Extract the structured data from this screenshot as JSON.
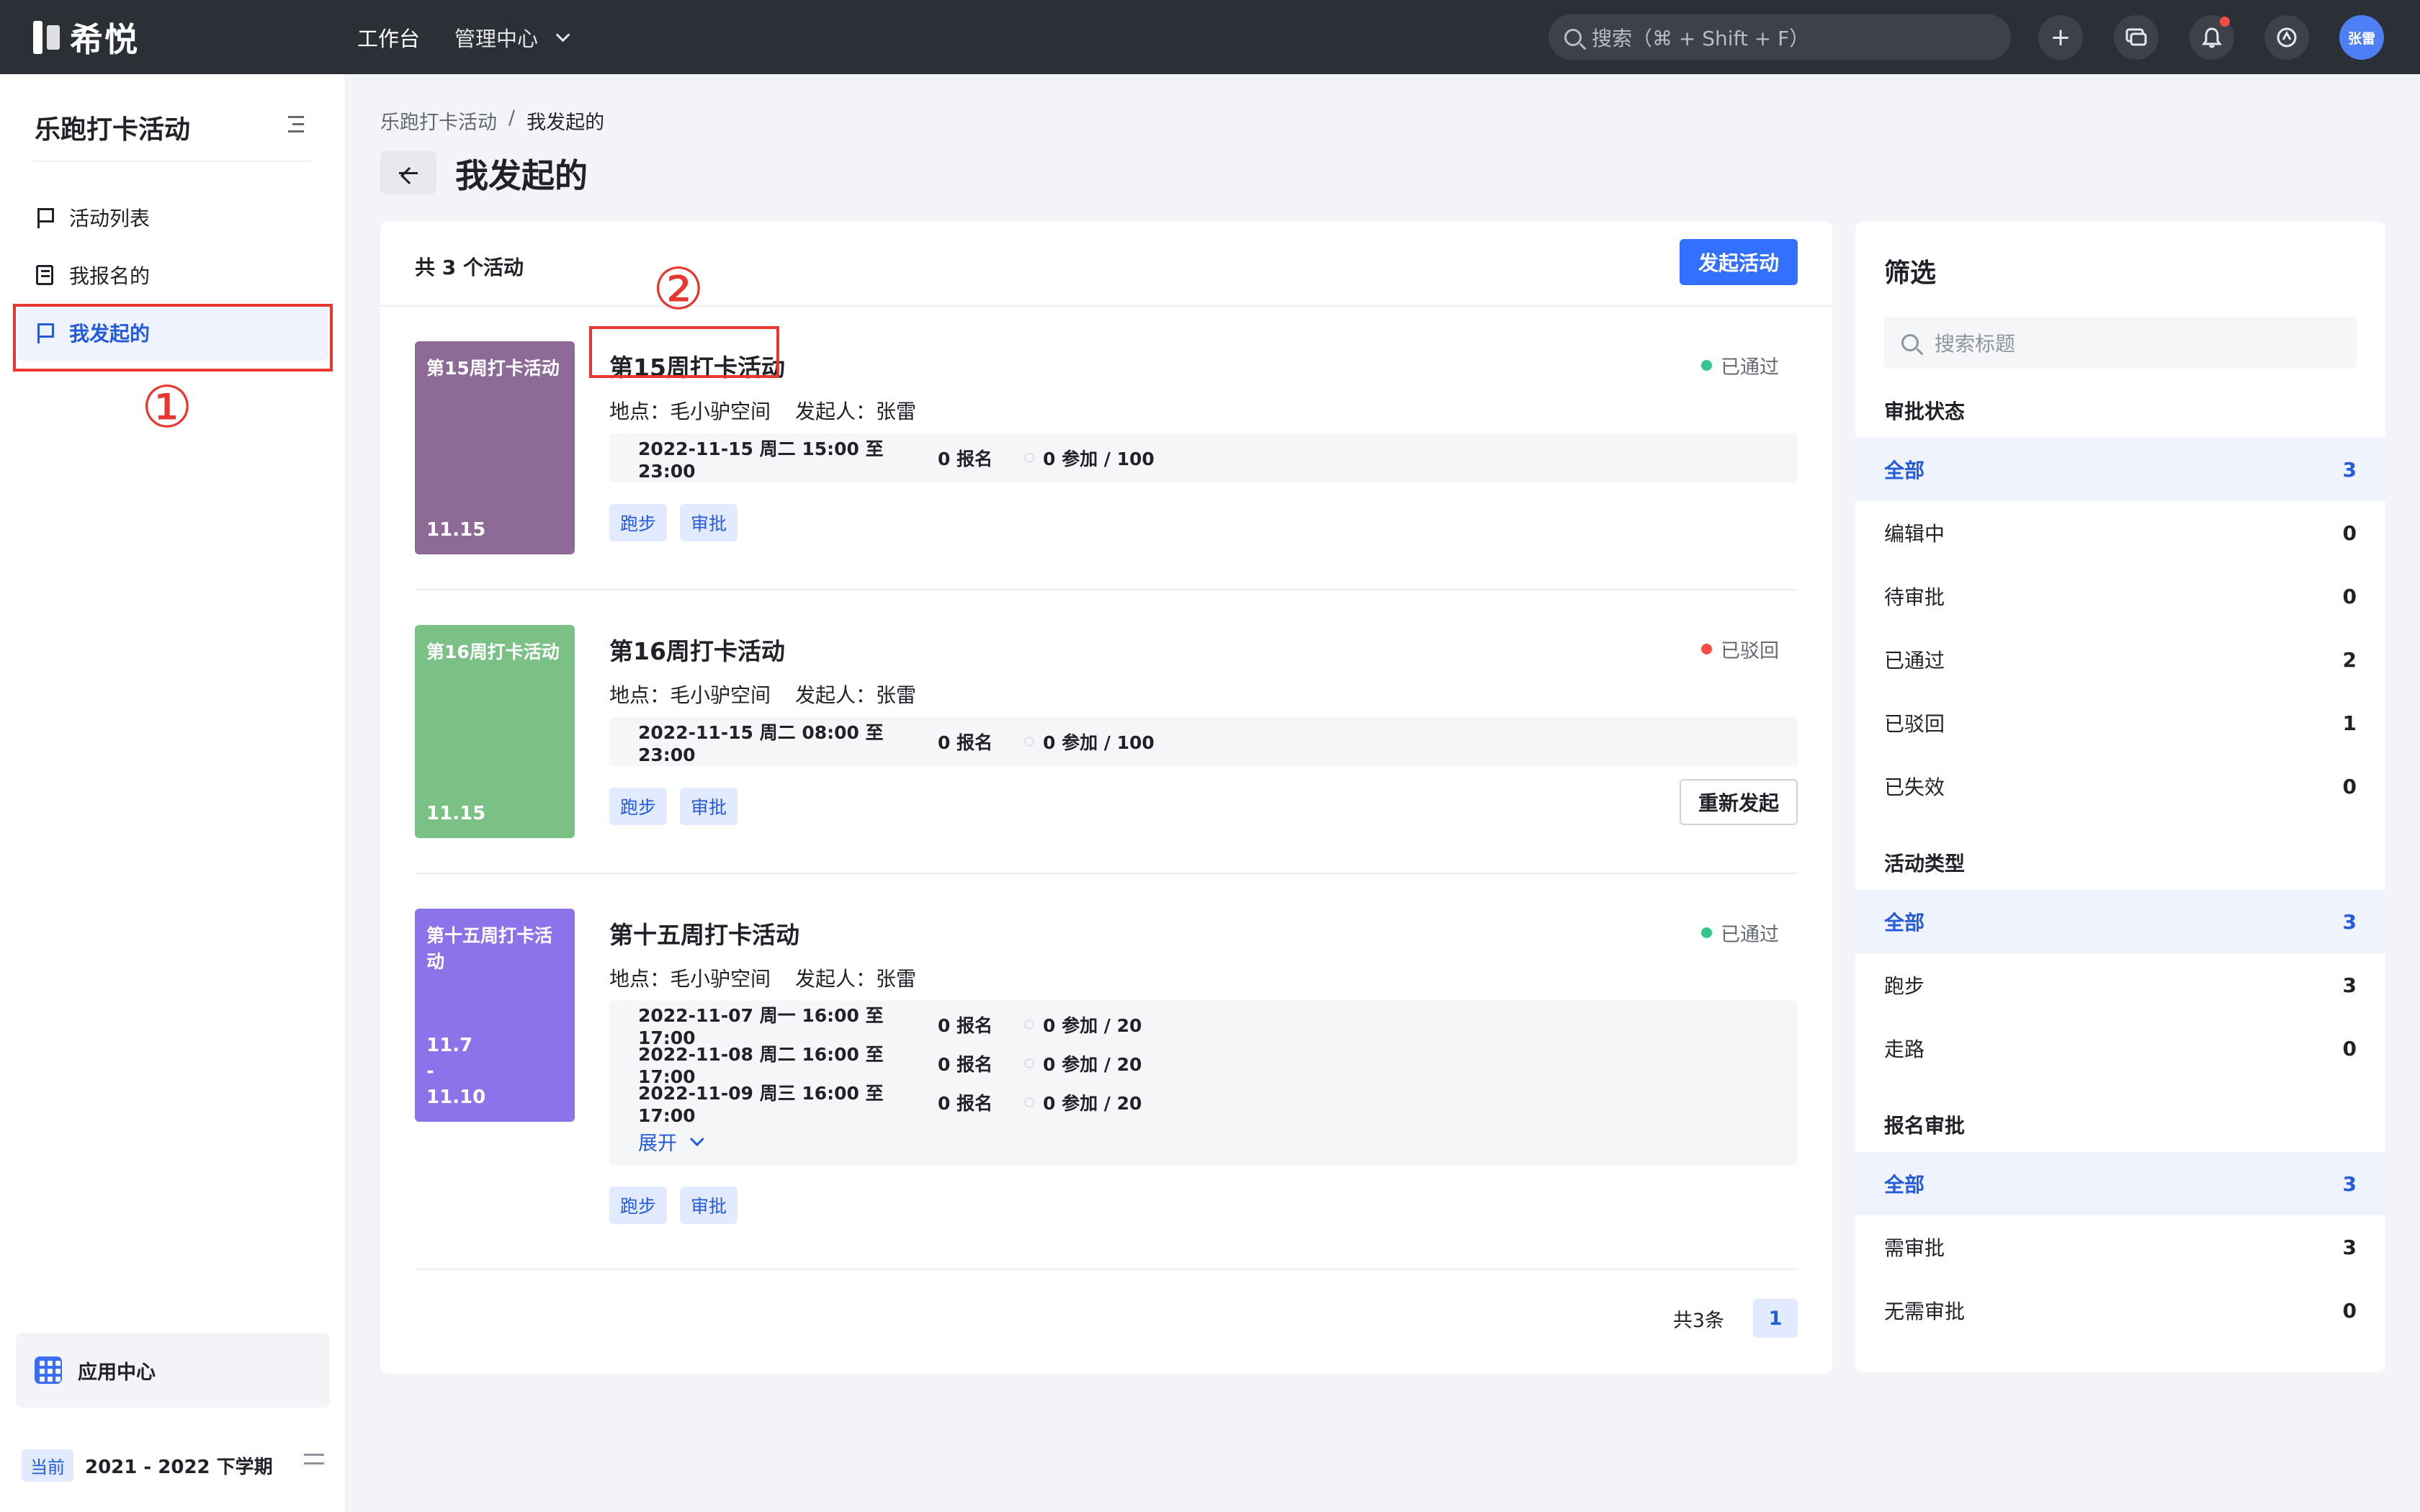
{
  "app": {
    "logo_text": "希悦"
  },
  "topnav": {
    "workbench": "工作台",
    "admin": "管理中心"
  },
  "search": {
    "placeholder": "搜索（⌘ + Shift + F）"
  },
  "topbar_icons": [
    "plus-icon",
    "chat-icon",
    "bell-icon",
    "help-icon"
  ],
  "user": {
    "avatar_text": "张雷"
  },
  "sidebar": {
    "title": "乐跑打卡活动",
    "items": [
      {
        "label": "活动列表",
        "icon": "flag-icon",
        "active": false
      },
      {
        "label": "我报名的",
        "icon": "form-icon",
        "active": false
      },
      {
        "label": "我发起的",
        "icon": "flag-icon",
        "active": true
      }
    ],
    "app_center": "应用中心",
    "term_badge": "当前",
    "term": "2021 - 2022 下学期"
  },
  "annotations": {
    "one": "①",
    "two": "②"
  },
  "breadcrumb": {
    "root": "乐跑打卡活动",
    "sep": "/",
    "current": "我发起的"
  },
  "page": {
    "title": "我发起的"
  },
  "list": {
    "count_text": "共 3 个活动",
    "create_button": "发起活动",
    "activities": [
      {
        "cover_title": "第15周打卡活动",
        "cover_date": "11.15",
        "cover_color": "#8d6b96",
        "title": "第15周打卡活动",
        "status": "已通过",
        "status_color": "#34c68d",
        "location": "地点：毛小驴空间",
        "initiator": "发起人：张雷",
        "sessions": [
          {
            "time": "2022-11-15 周二 15:00 至 23:00",
            "enrolled": "0 报名",
            "participants": "0 参加 / 100"
          }
        ],
        "tags": [
          "跑步",
          "审批"
        ]
      },
      {
        "cover_title": "第16周打卡活动",
        "cover_date": "11.15",
        "cover_color": "#7bc185",
        "title": "第16周打卡活动",
        "status": "已驳回",
        "status_color": "#f54a45",
        "location": "地点：毛小驴空间",
        "initiator": "发起人：张雷",
        "sessions": [
          {
            "time": "2022-11-15 周二 08:00 至 23:00",
            "enrolled": "0 报名",
            "participants": "0 参加 / 100"
          }
        ],
        "tags": [
          "跑步",
          "审批"
        ],
        "action_button": "重新发起"
      },
      {
        "cover_title": "第十五周打卡活动",
        "cover_date_lines": [
          "11.7",
          "-",
          "11.10"
        ],
        "cover_color": "#8c73e9",
        "title": "第十五周打卡活动",
        "status": "已通过",
        "status_color": "#34c68d",
        "location": "地点：毛小驴空间",
        "initiator": "发起人：张雷",
        "sessions": [
          {
            "time": "2022-11-07 周一 16:00 至 17:00",
            "enrolled": "0 报名",
            "participants": "0 参加 / 20"
          },
          {
            "time": "2022-11-08 周二 16:00 至 17:00",
            "enrolled": "0 报名",
            "participants": "0 参加 / 20"
          },
          {
            "time": "2022-11-09 周三 16:00 至 17:00",
            "enrolled": "0 报名",
            "participants": "0 参加 / 20"
          }
        ],
        "expand_label": "展开",
        "tags": [
          "跑步",
          "审批"
        ]
      }
    ],
    "pagination": {
      "total": "共3条",
      "current": "1"
    }
  },
  "filter": {
    "title": "筛选",
    "search_placeholder": "搜索标题",
    "groups": [
      {
        "title": "审批状态",
        "items": [
          {
            "label": "全部",
            "count": "3",
            "active": true
          },
          {
            "label": "编辑中",
            "count": "0"
          },
          {
            "label": "待审批",
            "count": "0"
          },
          {
            "label": "已通过",
            "count": "2"
          },
          {
            "label": "已驳回",
            "count": "1"
          },
          {
            "label": "已失效",
            "count": "0"
          }
        ]
      },
      {
        "title": "活动类型",
        "items": [
          {
            "label": "全部",
            "count": "3",
            "active": true
          },
          {
            "label": "跑步",
            "count": "3"
          },
          {
            "label": "走路",
            "count": "0"
          }
        ]
      },
      {
        "title": "报名审批",
        "items": [
          {
            "label": "全部",
            "count": "3",
            "active": true
          },
          {
            "label": "需审批",
            "count": "3"
          },
          {
            "label": "无需审批",
            "count": "0"
          }
        ]
      }
    ]
  }
}
